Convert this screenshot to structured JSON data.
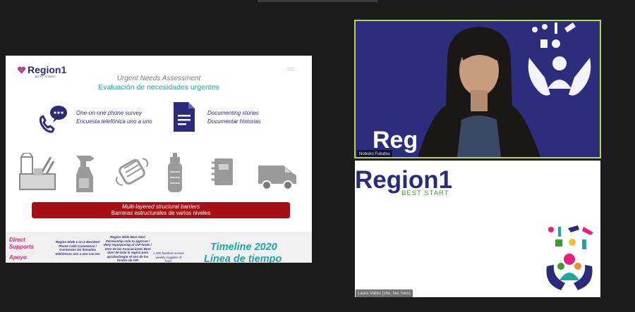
{
  "slide": {
    "logo": {
      "name": "Region1",
      "sub": "BEST START"
    },
    "title_en": "Urgent Needs Assessment",
    "title_es": "Evaluación de necesidades urgentes",
    "phone": {
      "en": "One-on-one phone survey",
      "es": "Encuesta telefónica uno a uno"
    },
    "doc": {
      "en": "Documenting stories",
      "es": "Documentar historias"
    },
    "banner": {
      "en": "Multi-layered structural barriers",
      "es": "Barreras estructurales de varios niveles"
    },
    "bottom": {
      "direct_en_1": "Direct",
      "direct_en_2": "Supports",
      "direct_es": "Apoyo",
      "col1": "Region Wide 1-on-1 Resident Phone Calls Commence / Comienzan las llamadas telefónicas uno a uno con los",
      "col2": "Region Wide Best Start Partnership vote to approve / deny repurposing of CIP funds / Voto de las Asociaciones Best Start de toda la región para aprobar/negar el uso de los fondos de CIP",
      "col3": "1,300 families receive weekly supplies of food,",
      "timeline_en": "Timeline 2020",
      "timeline_es": "Línea de tiempo"
    },
    "icons": [
      "groceries-icon",
      "spray-bottle-icon",
      "face-mask-icon",
      "baby-bottle-icon",
      "notebook-icon",
      "van-icon"
    ]
  },
  "participants": [
    {
      "name": "Nobuko Fukatsu",
      "bg_text": "Reg",
      "highlighted": true
    },
    {
      "name": "Laura Valles (she, her, hers)",
      "bg_title": "Region1",
      "bg_sub": "BEST START"
    }
  ],
  "colors": {
    "navy": "#2e2a7a",
    "teal": "#1fa6a3",
    "banner": "#a70f15",
    "pink": "#e6207f",
    "active_border": "#b9d63c"
  }
}
